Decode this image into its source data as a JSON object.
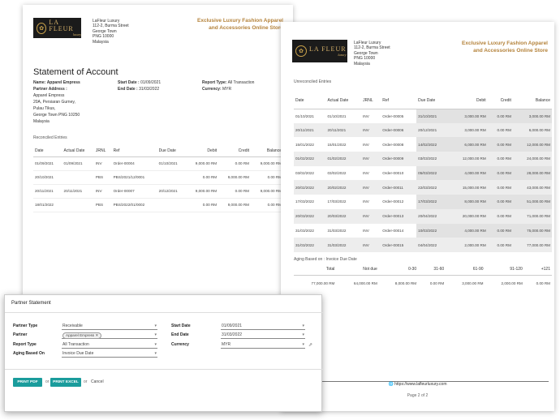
{
  "brand": {
    "logo_name": "LA FLEUR",
    "logo_sub": "luxury",
    "company_lines": [
      "LaFleur Luxury",
      "112-2, Burma Street",
      "George Town",
      "PNG 10000",
      "Malaysia"
    ],
    "tagline_lines": [
      "Exclusive Luxury Fashion Apparel",
      "and Accessories Online Store"
    ]
  },
  "statement": {
    "title": "Statement of Account",
    "name_label": "Name:",
    "name_value": "Apparel Empress",
    "partner_address_label": "Partner Address :",
    "address_lines": [
      "Apparel Empress",
      "20A, Persiaran Gurney,",
      "Pulau Tikus,",
      "George Town PNG 10250",
      "Malaysia"
    ],
    "start_label": "Start Date :",
    "start_value": "01/09/2021",
    "end_label": "End Date :",
    "end_value": "31/03/2022",
    "report_type_label": "Report Type:",
    "report_type_value": "All Transaction",
    "currency_label": "Currency:",
    "currency_value": "MYR"
  },
  "reconciled": {
    "label": "Reconciled Entries",
    "columns": [
      "Date",
      "Actual Date",
      "JRNL",
      "Ref",
      "Due Date",
      "Debit",
      "Credit",
      "Balance"
    ],
    "rows": [
      [
        "01/09/2021",
        "01/09/2021",
        "INV",
        "Order-00004",
        "01/10/2021",
        "9,000.00 RM",
        "0.00 RM",
        "9,000.00 RM"
      ],
      [
        "20/10/2021",
        "",
        "PBS",
        "PBS/2021/12/0001",
        "",
        "0.00 RM",
        "9,000.00 RM",
        "0.00 RM"
      ],
      [
        "20/11/2021",
        "20/11/2021",
        "INV",
        "Order-00007",
        "20/12/2021",
        "9,000.00 RM",
        "0.00 RM",
        "9,000.00 RM"
      ],
      [
        "18/01/2022",
        "",
        "PBS",
        "PBS/2022/01/0002",
        "",
        "0.00 RM",
        "9,000.00 RM",
        "0.00 RM"
      ]
    ]
  },
  "unreconciled": {
    "label": "Unreconciled Entries",
    "columns": [
      "Date",
      "Actual Date",
      "JRNL",
      "Ref",
      "Due Date",
      "Debit",
      "Credit",
      "Balance"
    ],
    "rows": [
      [
        "01/10/2021",
        "01/10/2021",
        "INV",
        "Order-00005",
        "31/10/2021",
        "3,000.00 RM",
        "0.00 RM",
        "3,000.00 RM"
      ],
      [
        "20/11/2021",
        "20/11/2021",
        "INV",
        "Order-00006",
        "20/12/2021",
        "3,000.00 RM",
        "0.00 RM",
        "6,000.00 RM"
      ],
      [
        "15/01/2022",
        "15/01/2022",
        "INV",
        "Order-00008",
        "14/02/2022",
        "6,000.00 RM",
        "0.00 RM",
        "12,000.00 RM"
      ],
      [
        "01/02/2022",
        "01/02/2022",
        "INV",
        "Order-00009",
        "03/03/2022",
        "12,000.00 RM",
        "0.00 RM",
        "24,000.00 RM"
      ],
      [
        "03/02/2022",
        "03/02/2022",
        "INV",
        "Order-00010",
        "05/03/2022",
        "4,000.00 RM",
        "0.00 RM",
        "28,000.00 RM"
      ],
      [
        "20/02/2022",
        "20/02/2022",
        "INV",
        "Order-00011",
        "22/03/2022",
        "15,000.00 RM",
        "0.00 RM",
        "43,000.00 RM"
      ],
      [
        "17/03/2022",
        "17/03/2022",
        "INV",
        "Order-00012",
        "17/03/2022",
        "8,000.00 RM",
        "0.00 RM",
        "51,000.00 RM"
      ],
      [
        "20/03/2022",
        "20/03/2022",
        "INV",
        "Order-00013",
        "20/04/2022",
        "20,000.00 RM",
        "0.00 RM",
        "71,000.00 RM"
      ],
      [
        "31/03/2022",
        "31/03/2022",
        "INV",
        "Order-00014",
        "10/03/2022",
        "4,000.00 RM",
        "0.00 RM",
        "75,000.00 RM"
      ],
      [
        "31/03/2022",
        "31/03/2022",
        "INV",
        "Order-00015",
        "04/04/2022",
        "2,000.00 RM",
        "0.00 RM",
        "77,000.00 RM"
      ]
    ]
  },
  "aging": {
    "label": "Aging Based on : Invoice Due Date",
    "columns": [
      "Total",
      "Not due",
      "0-30",
      "31-60",
      "61-90",
      "91-120",
      "+121"
    ],
    "row": [
      "77,000.00 RM",
      "64,000.00 RM",
      "8,000.00 RM",
      "0.00 RM",
      "3,000.00 RM",
      "2,000.00 RM",
      "0.00 RM"
    ]
  },
  "footer": {
    "url": "https://www.lafleurluxury.com",
    "page": "Page 2 of 2"
  },
  "dialog": {
    "title": "Partner Statement",
    "partner_type_label": "Partner Type",
    "partner_type_value": "Receivable",
    "partner_label": "Partner",
    "partner_chip": "Apparel Empress",
    "report_type_label": "Report Type",
    "report_type_value": "All Transaction",
    "aging_label": "Aging Based On",
    "aging_value": "Invoice Due Date",
    "start_label": "Start Date",
    "start_value": "01/09/2021",
    "end_label": "End Date",
    "end_value": "31/03/2022",
    "currency_label": "Currency",
    "currency_value": "MYR",
    "print_pdf": "PRINT PDF",
    "or1": "or",
    "print_excel": "PRINT EXCEL",
    "or2": "or",
    "cancel": "Cancel"
  }
}
